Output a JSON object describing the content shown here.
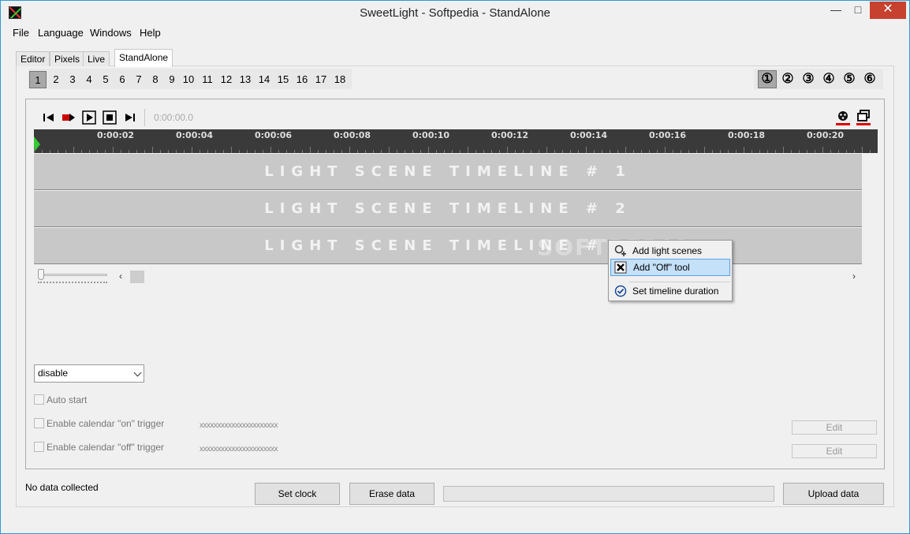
{
  "window": {
    "title": "SweetLight - Softpedia - StandAlone"
  },
  "menu": [
    "File",
    "Language",
    "Windows",
    "Help"
  ],
  "tabs": [
    {
      "label": "Editor",
      "active": false
    },
    {
      "label": "Pixels",
      "active": false
    },
    {
      "label": "Live",
      "active": false
    },
    {
      "label": "StandAlone",
      "active": true
    }
  ],
  "scene_numbers": [
    "1",
    "2",
    "3",
    "4",
    "5",
    "6",
    "7",
    "8",
    "9",
    "10",
    "11",
    "12",
    "13",
    "14",
    "15",
    "16",
    "17",
    "18"
  ],
  "scene_numbers_selected": "1",
  "circled_numbers": [
    "①",
    "②",
    "③",
    "④",
    "⑤",
    "⑥"
  ],
  "circled_selected": 0,
  "transport": {
    "time": "0:00:00.0",
    "icons": [
      "skip-start-icon",
      "record-icon",
      "play-icon",
      "stop-icon",
      "skip-end-icon"
    ]
  },
  "ruler": {
    "labels": [
      "0:00:02",
      "0:00:04",
      "0:00:06",
      "0:00:08",
      "0:00:10",
      "0:00:12",
      "0:00:14",
      "0:00:16",
      "0:00:18",
      "0:00:20"
    ]
  },
  "lanes": [
    "LIGHT SCENE TIMELINE # 1",
    "LIGHT SCENE TIMELINE # 2",
    "LIGHT SCENE TIMELINE # 3"
  ],
  "mode_select": {
    "value": "disable"
  },
  "options": {
    "auto_start": "Auto start",
    "calendar_on": "Enable calendar \"on\" trigger",
    "calendar_off": "Enable calendar \"off\" trigger",
    "mask_on": "xxxxxxxxxxxxxxxxxxxxxx",
    "mask_off": "xxxxxxxxxxxxxxxxxxxxxx",
    "edit_label": "Edit"
  },
  "footer": {
    "status": "No data collected",
    "set_clock": "Set clock",
    "erase_data": "Erase data",
    "upload_data": "Upload data"
  },
  "context_menu": {
    "items": [
      "Add light scenes",
      "Add \"Off\" tool",
      "Set timeline duration"
    ],
    "hovered": 1
  },
  "watermark": "SOFTPEDIA",
  "colors": {
    "accent": "#2b9bd6",
    "close": "#c7412f",
    "lane": "#c8c8c8",
    "ruler": "#3a3a3a",
    "menu_hover": "#c5e0f9"
  }
}
